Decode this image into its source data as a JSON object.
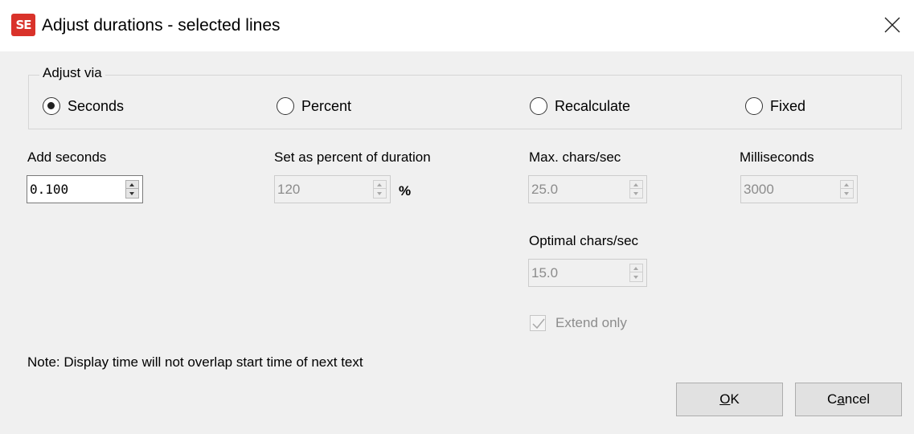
{
  "window": {
    "icon_text": "SE",
    "title": "Adjust durations - selected lines"
  },
  "adjust_via": {
    "legend": "Adjust via",
    "selected": "Seconds",
    "options": [
      "Seconds",
      "Percent",
      "Recalculate",
      "Fixed"
    ]
  },
  "add_seconds": {
    "label": "Add seconds",
    "value": "0.100",
    "enabled": true
  },
  "percent": {
    "label": "Set as percent of duration",
    "value": "120",
    "unit": "%",
    "enabled": false
  },
  "max_chars_sec": {
    "label": "Max. chars/sec",
    "value": "25.0",
    "enabled": false
  },
  "milliseconds": {
    "label": "Milliseconds",
    "value": "3000",
    "enabled": false
  },
  "optimal_chars_sec": {
    "label": "Optimal chars/sec",
    "value": "15.0",
    "enabled": false
  },
  "extend_only": {
    "label": "Extend only",
    "checked": true,
    "enabled": false
  },
  "note": "Note: Display time will not overlap start time of next text",
  "buttons": {
    "ok": {
      "mnemonic": "O",
      "rest": "K"
    },
    "cancel": {
      "pre": "C",
      "mnemonic": "a",
      "rest": "ncel"
    }
  },
  "icons": {
    "app": "subtitle-edit-app-icon",
    "close": "close-icon",
    "spin": "spin-up-down-icon",
    "check": "checkmark-icon"
  },
  "colors": {
    "app_icon": "#d9322a",
    "disabled_text": "#8c8c8c",
    "button_face": "#e1e1e1"
  }
}
